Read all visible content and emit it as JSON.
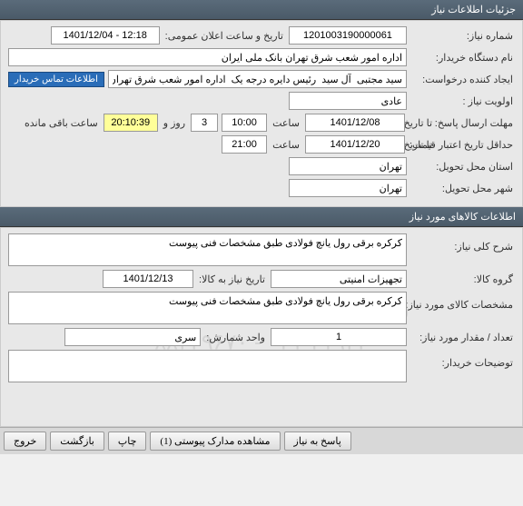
{
  "section1": {
    "title": "جزئیات اطلاعات نیاز"
  },
  "need": {
    "number_label": "شماره نیاز:",
    "number": "1201003190000061",
    "announce_label": "تاریخ و ساعت اعلان عمومی:",
    "announce_value": "1401/12/04 - 12:18",
    "buyer_label": "نام دستگاه خریدار:",
    "buyer": "اداره امور شعب شرق تهران بانک ملی ایران",
    "creator_label": "ایجاد کننده درخواست:",
    "creator": "سید مجتبی  آل سید  رئیس دایره درجه یک  اداره امور شعب شرق تهران بانک م",
    "contact_badge": "اطلاعات تماس خریدار",
    "priority_label": "اولویت نیاز :",
    "priority": "عادی",
    "deadline_label": "مهلت ارسال پاسخ:",
    "to_date_label": "تا تاریخ :",
    "deadline_date": "1401/12/08",
    "time_label": "ساعت",
    "deadline_time": "10:00",
    "remain_days": "3",
    "days_and": "روز و",
    "remain_time": "20:10:39",
    "remain_suffix": "ساعت باقی مانده",
    "validity_label": "حداقل تاریخ اعتبار قیمت:",
    "validity_date": "1401/12/20",
    "validity_time": "21:00",
    "province_label": "استان محل تحویل:",
    "province": "تهران",
    "city_label": "شهر محل تحویل:",
    "city": "تهران"
  },
  "section2": {
    "title": "اطلاعات کالاهای مورد نیاز"
  },
  "goods": {
    "desc_label": "شرح کلی نیاز:",
    "desc": "کرکره برقی رول یانچ فولادی طبق مشخصات فنی پیوست",
    "group_label": "گروه کالا:",
    "group": "تجهیزات امنیتی",
    "need_date_label": "تاریخ نیاز به کالا:",
    "need_date": "1401/12/13",
    "spec_label": "مشخصات کالای مورد نیاز:",
    "spec": "کرکره برقی رول یانچ فولادی طبق مشخصات فنی پیوست",
    "qty_label": "تعداد / مقدار مورد نیاز:",
    "qty": "1",
    "unit_label": "واحد شمارش:",
    "unit": "سری",
    "buyer_notes_label": "توضیحات خریدار:"
  },
  "watermark": {
    "line1": "سامانه تدارکات الکترونیکی دولت",
    "line2": "۰۲۱-۴۱۹۳۴ - ۸۸۳۴۹۶۷۰"
  },
  "buttons": {
    "respond": "پاسخ به نیاز",
    "attachments": "مشاهده مدارک پیوستی (1)",
    "print": "چاپ",
    "back": "بازگشت",
    "exit": "خروج"
  }
}
